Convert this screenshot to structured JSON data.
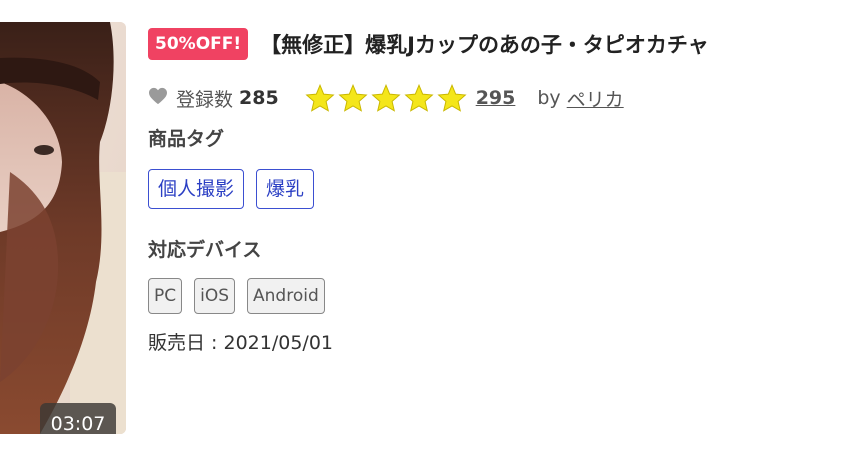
{
  "thumbnail": {
    "duration": "03:07"
  },
  "product": {
    "sale_badge": "50%OFF!",
    "title": "【無修正】爆乳Jカップのあの子・タピオカチャ",
    "favorites": {
      "label": "登録数",
      "count": "285"
    },
    "rating": {
      "stars": 5,
      "max": 5,
      "review_count": "295",
      "star_color": "#f4e61a"
    },
    "seller": {
      "by_label": "by",
      "name": "ペリカ"
    },
    "tags_label": "商品タグ",
    "tags": [
      "個人撮影",
      "爆乳"
    ],
    "devices_label": "対応デバイス",
    "devices": [
      "PC",
      "iOS",
      "Android"
    ],
    "release_date": "販売日 : 2021/05/01"
  },
  "colors": {
    "sale_badge": "#f04262",
    "tag_border": "#3b4fd1",
    "tag_text": "#2b3fc4"
  }
}
